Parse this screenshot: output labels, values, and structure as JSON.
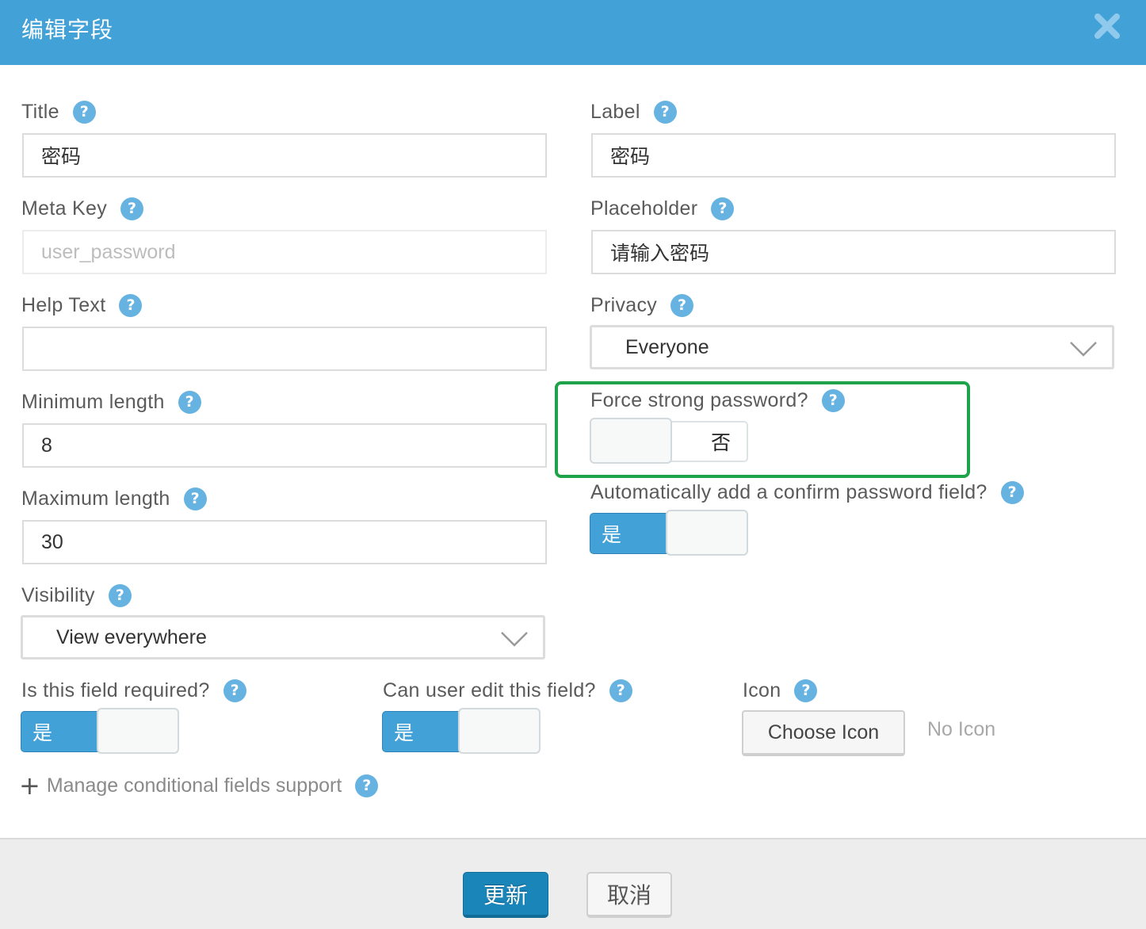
{
  "dialog": {
    "title": "编辑字段",
    "close_icon": "close-x-icon",
    "header_color": "#42a1d7"
  },
  "fields": {
    "title": {
      "label": "Title",
      "value": "密码"
    },
    "label": {
      "label": "Label",
      "value": "密码"
    },
    "meta_key": {
      "label": "Meta Key",
      "placeholder": "user_password",
      "value": ""
    },
    "placeholder": {
      "label": "Placeholder",
      "value": "请输入密码"
    },
    "help_text": {
      "label": "Help Text",
      "value": ""
    },
    "privacy": {
      "label": "Privacy",
      "selected": "Everyone"
    },
    "min_length": {
      "label": "Minimum length",
      "value": "8"
    },
    "max_length": {
      "label": "Maximum length",
      "value": "30"
    },
    "visibility": {
      "label": "Visibility",
      "selected": "View everywhere"
    },
    "force_strong_password": {
      "label": "Force strong password?",
      "state": "off",
      "off_label": "否"
    },
    "confirm_password": {
      "label": "Automatically add a confirm password field?",
      "state": "on",
      "on_label": "是"
    },
    "required": {
      "label": "Is this field required?",
      "state": "on",
      "on_label": "是"
    },
    "editable": {
      "label": "Can user edit this field?",
      "state": "on",
      "on_label": "是"
    },
    "icon": {
      "label": "Icon",
      "button_label": "Choose Icon",
      "status": "No Icon"
    }
  },
  "help_icon": {
    "name": "help-question-icon",
    "glyph": "?",
    "color": "#66b3e2"
  },
  "conditional": {
    "plus_glyph": "+",
    "label": "Manage conditional fields support"
  },
  "highlight": {
    "color": "#1fa34a",
    "target": "force_strong_password"
  },
  "footer": {
    "update_label": "更新",
    "cancel_label": "取消",
    "primary_color": "#1a85b8"
  }
}
